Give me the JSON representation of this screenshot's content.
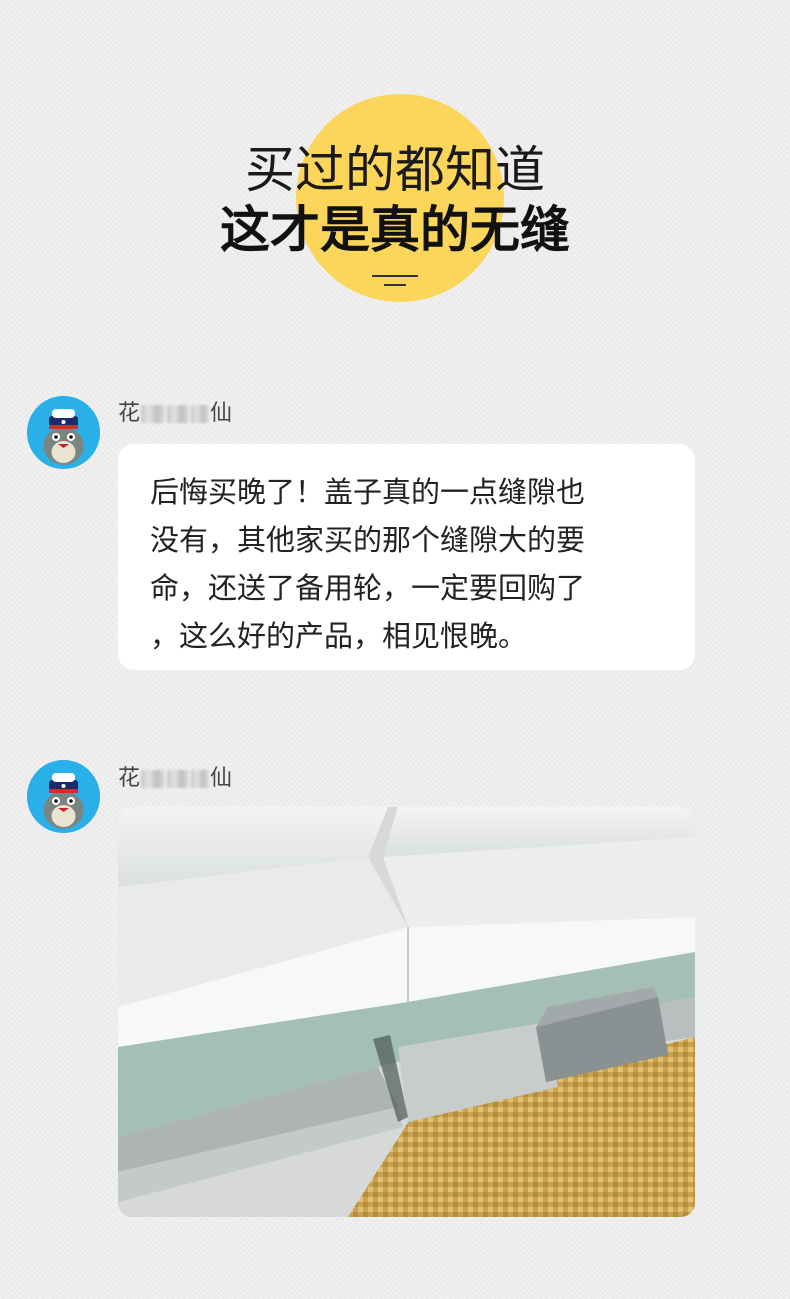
{
  "header": {
    "line1": "买过的都知道",
    "line2": "这才是真的无缝",
    "accent_color": "#fbd65a"
  },
  "posts": [
    {
      "username_prefix": "花",
      "username_suffix": "仙",
      "avatar_icon": "totoro-sailor-avatar",
      "lines": [
        "后悔买晚了！盖子真的一点缝隙也",
        "没有，其他家买的那个缝隙大的要",
        "命，还送了备用轮，一定要回购了",
        "，这么好的产品，相见恨晚。"
      ]
    },
    {
      "username_prefix": "花",
      "username_suffix": "仙",
      "avatar_icon": "totoro-sailor-avatar",
      "photo_icon": "storage-box-lid-closeup-photo"
    }
  ]
}
